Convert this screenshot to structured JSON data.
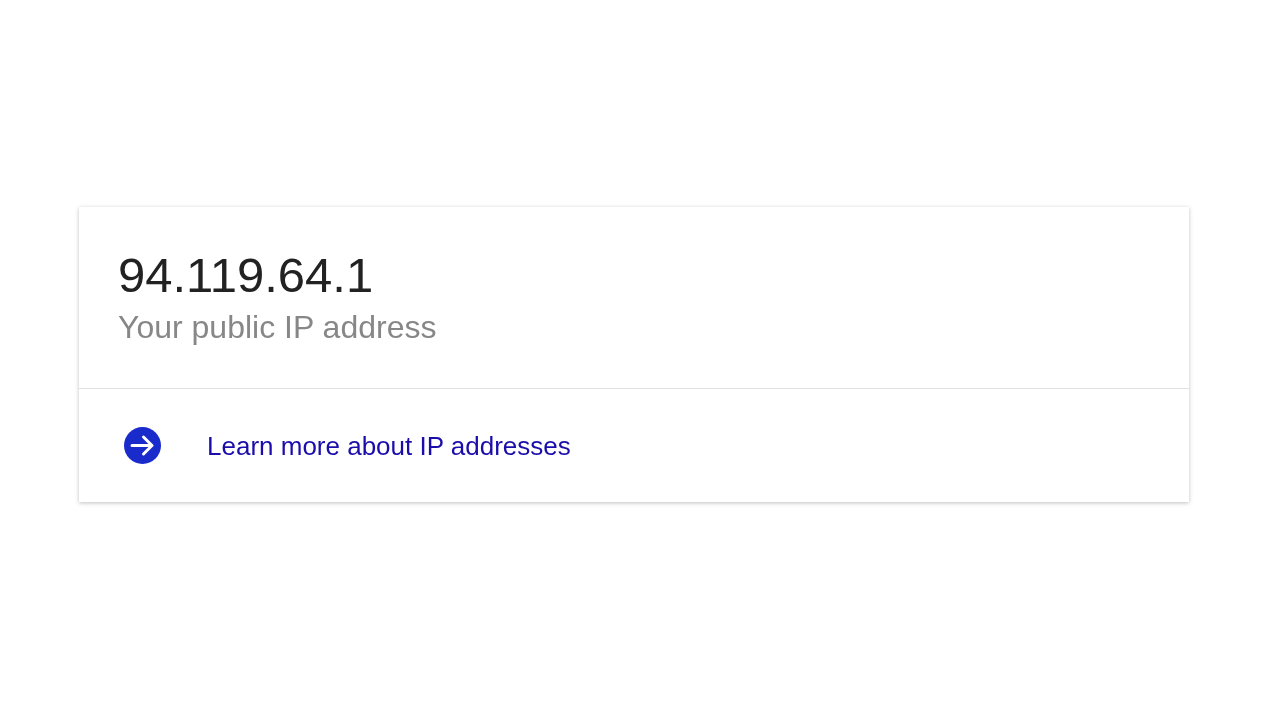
{
  "result_card": {
    "ip_address": "94.119.64.1",
    "caption": "Your public IP address",
    "link": {
      "label": "Learn more about IP addresses"
    }
  }
}
